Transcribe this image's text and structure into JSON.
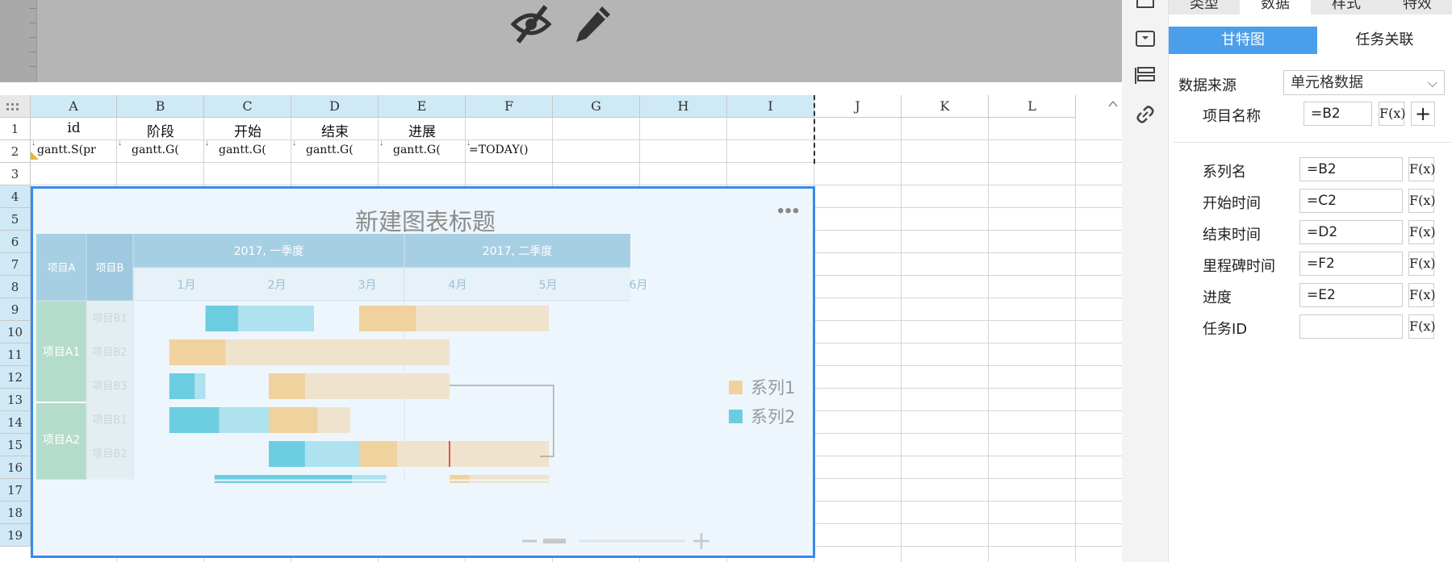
{
  "toolbar": {
    "hide_icon": "eye-off-icon",
    "edit_icon": "pencil-icon"
  },
  "sheet": {
    "columns": [
      "A",
      "B",
      "C",
      "D",
      "E",
      "F",
      "G",
      "H",
      "I",
      "J",
      "K",
      "L"
    ],
    "rows": [
      "1",
      "2",
      "3",
      "4",
      "5",
      "6",
      "7",
      "8",
      "9",
      "10",
      "11",
      "12",
      "13",
      "14",
      "15",
      "16",
      "17",
      "18",
      "19"
    ],
    "row1": [
      "id",
      "阶段",
      "开始",
      "结束",
      "进展"
    ],
    "row2": [
      "gantt.S(pr",
      "gantt.G(",
      "gantt.G(",
      "gantt.G(",
      "gantt.G(",
      "=TODAY()"
    ]
  },
  "chart": {
    "title": "新建图表标题",
    "more_icon": "more-icon",
    "header_cols": [
      "项目A",
      "项目B"
    ],
    "quarters": [
      "2017, 一季度",
      "2017, 二季度"
    ],
    "months": [
      "1月",
      "2月",
      "3月",
      "4月",
      "5月",
      "6月"
    ],
    "groups": [
      "项目A1",
      "项目A2"
    ],
    "tasks": [
      "项目B1",
      "项目B2",
      "项目B3",
      "项目B1",
      "项目B2"
    ],
    "legend": [
      {
        "label": "系列1",
        "color": "#f0d29e"
      },
      {
        "label": "系列2",
        "color": "#6ccde0"
      }
    ],
    "colors": {
      "series1": "#f0d29e",
      "series1_light": "#f0e3cd",
      "series2": "#6ccde0",
      "series2_light": "#aee2ee",
      "header": "#a6cfe3",
      "group": "#b4dcca",
      "border": "#3a88e8"
    }
  },
  "chart_data": {
    "type": "gantt",
    "title": "新建图表标题",
    "x_axis": {
      "quarters": [
        "2017, 一季度",
        "2017, 二季度"
      ],
      "months": [
        "1月",
        "2月",
        "3月",
        "4月",
        "5月",
        "6月"
      ]
    },
    "series": [
      {
        "name": "系列1"
      },
      {
        "name": "系列2"
      }
    ],
    "tasks": [
      {
        "group": "项目A1",
        "task": "项目B1",
        "series": "系列2",
        "start_month": 1.3,
        "end_month": 2.5,
        "progress": 0.3
      },
      {
        "group": "项目A1",
        "task": "项目B1",
        "series": "系列1",
        "start_month": 3.0,
        "end_month": 5.1,
        "progress": 0.3
      },
      {
        "group": "项目A1",
        "task": "项目B2",
        "series": "系列1",
        "start_month": 0.9,
        "end_month": 4.0,
        "progress": 0.2
      },
      {
        "group": "项目A1",
        "task": "项目B3",
        "series": "系列2",
        "start_month": 0.9,
        "end_month": 1.3,
        "progress": 0.7
      },
      {
        "group": "项目A1",
        "task": "项目B3",
        "series": "系列1",
        "start_month": 2.0,
        "end_month": 4.0,
        "progress": 0.2
      },
      {
        "group": "项目A2",
        "task": "项目B1",
        "series": "系列2",
        "start_month": 0.9,
        "end_month": 2.0,
        "progress": 0.5
      },
      {
        "group": "项目A2",
        "task": "项目B1",
        "series": "系列1",
        "start_month": 2.0,
        "end_month": 2.9,
        "progress": 0.6
      },
      {
        "group": "项目A2",
        "task": "项目B2",
        "series": "系列2",
        "start_month": 2.0,
        "end_month": 3.0,
        "progress": 0.4
      },
      {
        "group": "项目A2",
        "task": "项目B2",
        "series": "系列1",
        "start_month": 3.0,
        "end_month": 5.1,
        "progress": 0.2
      }
    ]
  },
  "right_strip": {
    "icons": [
      "window-icon",
      "dropdown-box-icon",
      "layout-icon",
      "link-icon"
    ]
  },
  "panel": {
    "tabs": [
      "类型",
      "数据",
      "样式",
      "特效"
    ],
    "active_tab": "数据",
    "subtabs": [
      "甘特图",
      "任务关联"
    ],
    "source_label": "数据来源",
    "source_value": "单元格数据",
    "project_name_label": "项目名称",
    "project_name_value": "=B2",
    "fx_label": "F(x)",
    "add_label": "+",
    "fields": [
      {
        "label": "系列名",
        "value": "=B2"
      },
      {
        "label": "开始时间",
        "value": "=C2"
      },
      {
        "label": "结束时间",
        "value": "=D2"
      },
      {
        "label": "里程碑时间",
        "value": "=F2"
      },
      {
        "label": "进度",
        "value": "=E2"
      },
      {
        "label": "任务ID",
        "value": ""
      }
    ]
  }
}
